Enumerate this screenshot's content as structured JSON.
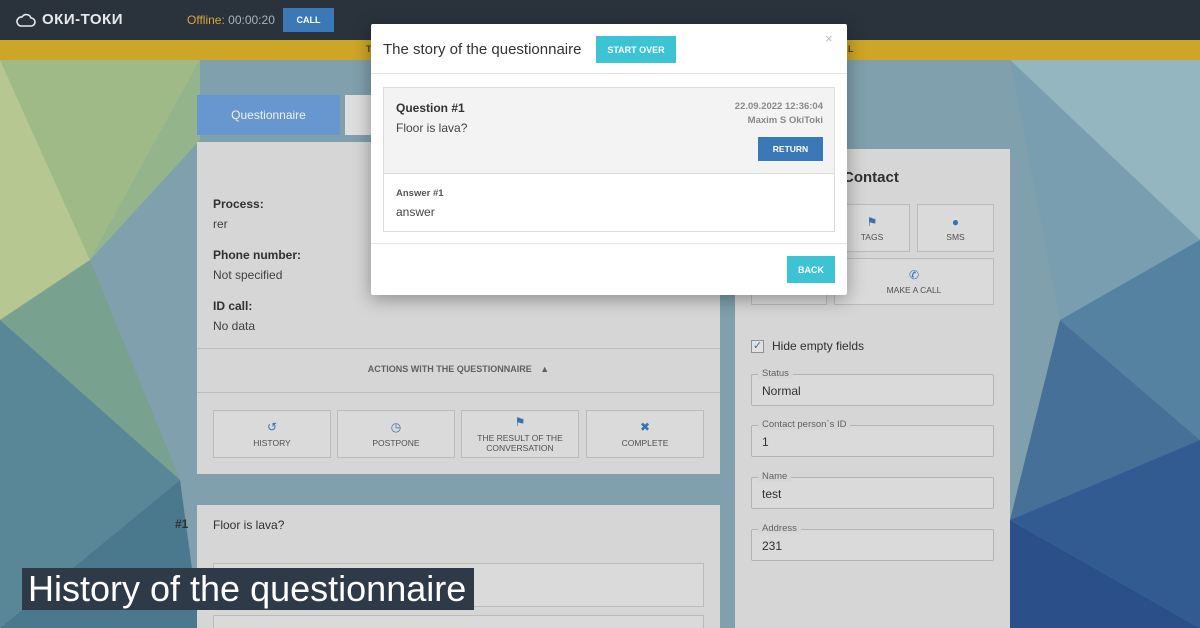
{
  "topbar": {
    "logo_text": "ОКИ-ТОКИ",
    "offline_label": "Offline:",
    "timer": "00:00:20",
    "call_label": "CALL"
  },
  "yellowbar": {
    "text_left": "T",
    "text_right": "L"
  },
  "tabs": {
    "questionnaire_label": "Questionnaire"
  },
  "left_card": {
    "fields": [
      {
        "label": "Process:",
        "value": "rer"
      },
      {
        "label": "Phone number:",
        "value": "Not specified"
      },
      {
        "label": "ID call:",
        "value": "No data"
      }
    ],
    "actions_toggle": "ACTIONS WITH THE QUESTIONNAIRE",
    "actions": [
      {
        "label": "HISTORY",
        "icon": "history-icon"
      },
      {
        "label": "POSTPONE",
        "icon": "clock-icon"
      },
      {
        "label": "THE RESULT OF THE CONVERSATION",
        "icon": "flag-icon"
      },
      {
        "label": "COMPLETE",
        "icon": "close-icon"
      }
    ]
  },
  "question": {
    "number": "#1",
    "text": "Floor is lava?"
  },
  "right_card": {
    "title": "Contact",
    "buttons": [
      {
        "label": "TAGS",
        "icon": "tags-icon"
      },
      {
        "label": "SMS",
        "icon": "chat-icon"
      },
      {
        "label": "MAKE A CALL",
        "icon": "phone-icon"
      }
    ],
    "hide_empty_label": "Hide empty fields",
    "hide_empty_checked": true,
    "fields": [
      {
        "label": "Status",
        "value": "Normal"
      },
      {
        "label": "Contact person`s ID",
        "value": "1"
      },
      {
        "label": "Name",
        "value": "test"
      },
      {
        "label": "Address",
        "value": "231"
      }
    ]
  },
  "modal": {
    "title": "The story of the questionnaire",
    "start_over_label": "START OVER",
    "close_glyph": "×",
    "entry": {
      "question_title": "Question #1",
      "question_text": "Floor is lava?",
      "date": "22.09.2022 12:36:04",
      "user": "Maxim S OkiToki",
      "return_label": "RETURN",
      "answer_title": "Answer #1",
      "answer_text": "answer"
    },
    "back_label": "BACK"
  },
  "caption": "History of the questionnaire",
  "colors": {
    "accent_blue": "#3a78b8",
    "accent_cyan": "#3cc4d4",
    "topbar": "#2a323c",
    "warning_bar": "#d8ae2a"
  }
}
